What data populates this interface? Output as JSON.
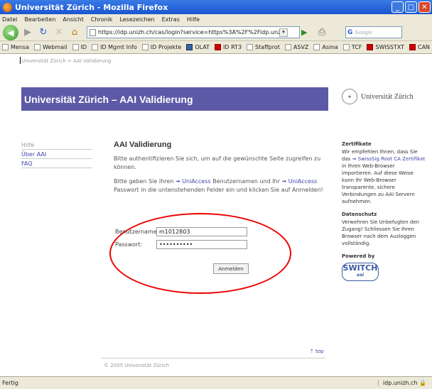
{
  "window": {
    "title": "Universität Zürich - Mozilla Firefox"
  },
  "menu": [
    "Datei",
    "Bearbeiten",
    "Ansicht",
    "Chronik",
    "Lesezeichen",
    "Extras",
    "Hilfe"
  ],
  "navbar": {
    "url": "https://idp.unizh.ch/cas/login?service=https%3A%2F%2Fidp.unz",
    "search_placeholder": "Google"
  },
  "bookmarks": [
    {
      "label": "Mensa",
      "icon": "page-icon"
    },
    {
      "label": "Webmail",
      "icon": "page-icon"
    },
    {
      "label": "ID",
      "icon": "page-icon"
    },
    {
      "label": "ID Mgmt Info",
      "icon": "page-icon"
    },
    {
      "label": "ID Projekte",
      "icon": "page-icon"
    },
    {
      "label": "OLAT",
      "icon": "olat-icon"
    },
    {
      "label": "ID RT3",
      "icon": "rt-icon"
    },
    {
      "label": "Staffprot",
      "icon": "page-icon"
    },
    {
      "label": "ASVZ",
      "icon": "page-icon"
    },
    {
      "label": "Asma",
      "icon": "page-icon"
    },
    {
      "label": "TCF",
      "icon": "page-icon"
    },
    {
      "label": "SWISSTXT",
      "icon": "swisstxt-icon"
    },
    {
      "label": "CAN",
      "icon": "can-icon"
    }
  ],
  "page": {
    "breadcrumb": "Universität Zürich > AAI Validierung",
    "banner_title": "Universität Zürich – AAI Validierung",
    "logo_text": "Universität Zürich",
    "sidenav": [
      "Hilfe",
      "Über AAI",
      "FAQ"
    ],
    "heading": "AAI Validierung",
    "para1": "Bitte authentifizieren Sie sich, um auf die gewünschte Seite zugreifen zu können.",
    "para2_a": "Bitte geben Sie Ihren ",
    "para2_link1": "UniAccess",
    "para2_b": " Benutzernamen und Ihr ",
    "para2_link2": "UniAccess",
    "para2_c": " Passwort in die untenstehenden Felder ein und klicken Sie auf Anmelden!",
    "username_label": "Benutzername:",
    "username_value": "m1012803",
    "password_label": "Passwort:",
    "password_value": "••••••••••",
    "login_button": "Anmelden",
    "right": {
      "cert_heading": "Zertifikate",
      "cert_text_a": "Wir empfehlen Ihnen, dass Sie das ",
      "cert_link": "SwissSig Root CA Zertifikat",
      "cert_text_b": " in Ihren Web-Browser importieren. Auf diese Weise kann Ihr Web-Browser transparente, sichere Verbindungen zu AAI Servern aufnehmen.",
      "privacy_heading": "Datenschutz",
      "privacy_text": "Verwehren Sie Unbefugten den Zugang! Schliessen Sie Ihren Browser nach dem Ausloggen vollständig.",
      "powered": "Powered by",
      "switch_logo": "SWITCH",
      "switch_sub": "aai"
    },
    "top_link": "top",
    "copyright": "© 2005 Universität Zürich"
  },
  "status": {
    "text": "Fertig",
    "host": "idp.unizh.ch"
  }
}
